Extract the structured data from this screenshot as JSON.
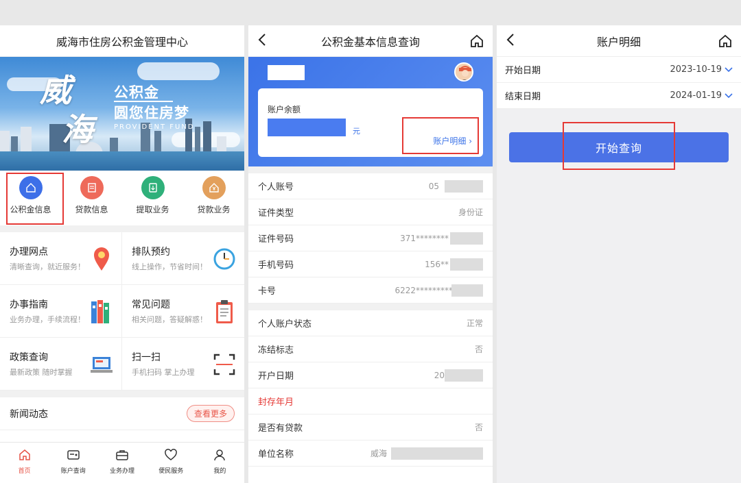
{
  "screen1": {
    "title": "威海市住房公积金管理中心",
    "banner": {
      "calligraphy_1": "威",
      "calligraphy_2": "海",
      "tagline_1": "公积金",
      "tagline_2": "圆您住房梦",
      "tagline_3": "PROVIDENT FUND"
    },
    "quick_items": [
      {
        "label": "公积金信息",
        "icon": "house-icon",
        "color": "#3d6fe8"
      },
      {
        "label": "贷款信息",
        "icon": "loan-doc-icon",
        "color": "#ee6a5a"
      },
      {
        "label": "提取业务",
        "icon": "withdraw-icon",
        "color": "#2fb07a"
      },
      {
        "label": "贷款业务",
        "icon": "house-yuan-icon",
        "color": "#e3a05c"
      }
    ],
    "grid": [
      {
        "title": "办理网点",
        "desc": "清晰查询，就近服务！",
        "icon": "location-pin-icon"
      },
      {
        "title": "排队预约",
        "desc": "线上操作，节省时间！",
        "icon": "clock-icon"
      },
      {
        "title": "办事指南",
        "desc": "业务办理，手续流程！",
        "icon": "binders-icon"
      },
      {
        "title": "常见问题",
        "desc": "相关问题，答疑解惑！",
        "icon": "clipboard-icon"
      },
      {
        "title": "政策查询",
        "desc": "最新政策 随时掌握",
        "icon": "laptop-icon"
      },
      {
        "title": "扫一扫",
        "desc": "手机扫码 掌上办理",
        "icon": "scan-icon"
      }
    ],
    "news": {
      "title": "新闻动态",
      "more": "查看更多"
    },
    "tabs": [
      {
        "label": "首页",
        "icon": "home-icon"
      },
      {
        "label": "账户查询",
        "icon": "account-card-icon"
      },
      {
        "label": "业务办理",
        "icon": "briefcase-icon"
      },
      {
        "label": "便民服务",
        "icon": "heart-icon"
      },
      {
        "label": "我的",
        "icon": "user-icon"
      }
    ]
  },
  "screen2": {
    "title": "公积金基本信息查询",
    "balance_label": "账户余额",
    "balance_unit": "元",
    "detail_link": "账户明细",
    "rows_a": [
      {
        "k": "个人账号",
        "v": "05"
      },
      {
        "k": "证件类型",
        "v": "身份证"
      },
      {
        "k": "证件号码",
        "v": "371********"
      },
      {
        "k": "手机号码",
        "v": "156**"
      },
      {
        "k": "卡号",
        "v": "6222*********"
      }
    ],
    "rows_b": [
      {
        "k": "个人账户状态",
        "v": "正常"
      },
      {
        "k": "冻结标志",
        "v": "否"
      },
      {
        "k": "开户日期",
        "v": "20"
      },
      {
        "k": "封存年月",
        "v": ""
      },
      {
        "k": "是否有贷款",
        "v": "否"
      },
      {
        "k": "单位名称",
        "v": "威海"
      }
    ]
  },
  "screen3": {
    "title": "账户明细",
    "start_label": "开始日期",
    "start_value": "2023-10-19",
    "end_label": "结束日期",
    "end_value": "2024-01-19",
    "query_button": "开始查询"
  }
}
